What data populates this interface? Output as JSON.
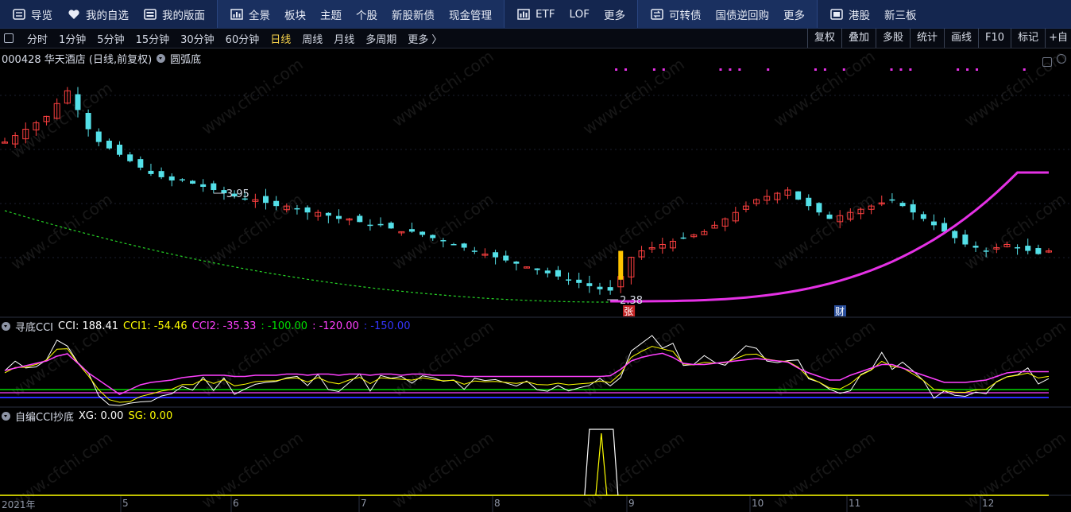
{
  "nav": {
    "items": [
      {
        "label": "导览",
        "icon": "menu-icon",
        "group": "a"
      },
      {
        "label": "我的自选",
        "icon": "heart-icon",
        "group": "a"
      },
      {
        "label": "我的版面",
        "icon": "layout-icon",
        "group": "a"
      },
      {
        "label": "全景",
        "icon": "chart-grid-icon",
        "group": "b"
      },
      {
        "label": "板块",
        "icon": "",
        "group": "b"
      },
      {
        "label": "主题",
        "icon": "",
        "group": "b"
      },
      {
        "label": "个股",
        "icon": "",
        "group": "b"
      },
      {
        "label": "新股新债",
        "icon": "",
        "group": "b"
      },
      {
        "label": "现金管理",
        "icon": "",
        "group": "b"
      },
      {
        "label": "ETF",
        "icon": "bar-chart-icon",
        "group": "c"
      },
      {
        "label": "LOF",
        "icon": "",
        "group": "c"
      },
      {
        "label": "更多",
        "icon": "",
        "group": "c"
      },
      {
        "label": "可转债",
        "icon": "convertible-bond-icon",
        "group": "d"
      },
      {
        "label": "国债逆回购",
        "icon": "",
        "group": "d"
      },
      {
        "label": "更多",
        "icon": "",
        "group": "d"
      },
      {
        "label": "港股",
        "icon": "hk-stock-icon",
        "group": "e"
      },
      {
        "label": "新三板",
        "icon": "",
        "group": "e"
      }
    ]
  },
  "toolbar": {
    "periods": [
      "分时",
      "1分钟",
      "5分钟",
      "15分钟",
      "30分钟",
      "60分钟",
      "日线",
      "周线",
      "月线",
      "多周期",
      "更多 〉"
    ],
    "active_period": "日线",
    "right_buttons": [
      "复权",
      "叠加",
      "多股",
      "统计",
      "画线",
      "F10",
      "标记",
      "+自"
    ]
  },
  "main_chart": {
    "title": "000428 华天酒店 (日线,前复权)",
    "indicator": "圆弧底",
    "high_label": "3.95",
    "low_label": "2.38",
    "zhang_badge": "张",
    "cai_badge": "财",
    "candles_close_est": [
      4.7,
      4.8,
      4.9,
      5.0,
      5.1,
      5.3,
      5.5,
      5.2,
      4.9,
      4.7,
      4.6,
      4.5,
      4.4,
      4.3,
      4.2,
      4.15,
      4.1,
      4.1,
      4.05,
      4.0,
      3.95,
      3.9,
      3.85,
      3.8,
      3.8,
      3.75,
      3.7,
      3.7,
      3.65,
      3.6,
      3.6,
      3.55,
      3.5,
      3.5,
      3.45,
      3.4,
      3.4,
      3.35,
      3.3,
      3.3,
      3.25,
      3.2,
      3.15,
      3.1,
      3.05,
      3.0,
      2.95,
      2.9,
      2.85,
      2.8,
      2.75,
      2.7,
      2.65,
      2.6,
      2.55,
      2.5,
      2.45,
      2.4,
      2.38,
      2.6,
      2.9,
      3.0,
      3.05,
      3.1,
      3.15,
      3.2,
      3.25,
      3.3,
      3.4,
      3.5,
      3.6,
      3.7,
      3.8,
      3.85,
      3.9,
      3.95,
      3.8,
      3.7,
      3.6,
      3.5,
      3.55,
      3.6,
      3.65,
      3.7,
      3.75,
      3.8,
      3.7,
      3.6,
      3.5,
      3.4,
      3.3,
      3.2,
      3.1,
      3.05,
      3.0,
      3.05,
      3.1,
      3.05,
      3.0,
      2.95,
      3.0
    ]
  },
  "cci_panel": {
    "title": "寻底CCI",
    "cci_label": "CCI: 188.41",
    "cci1_label": "CCI1: -54.46",
    "cci2_label": "CCI2: -35.33",
    "l1_label": ": -100.00",
    "l2_label": ": -120.00",
    "l3_label": ": -150.00",
    "colors": {
      "cci": "#ffffff",
      "cci1": "#ffff00",
      "cci2": "#ff40ff",
      "l1": "#00ff00",
      "l2": "#ff40ff",
      "l3": "#2a2aff"
    }
  },
  "cci2_panel": {
    "title": "自编CCI抄底",
    "xg_label": "XG: 0.00",
    "sg_label": "SG: 0.00"
  },
  "xaxis": {
    "labels": [
      "2021年",
      "5",
      "6",
      "7",
      "8",
      "9",
      "10",
      "11",
      "12"
    ]
  },
  "watermark": "www.cfchi.com"
}
